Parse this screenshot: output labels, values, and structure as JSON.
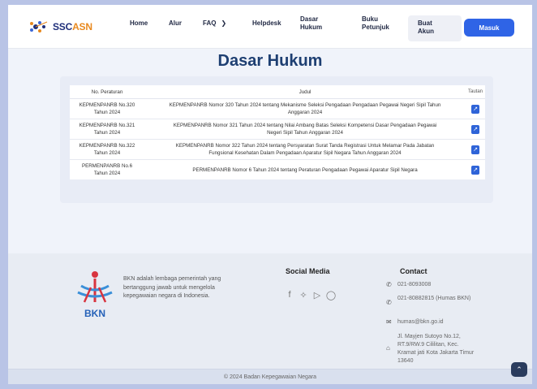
{
  "brand": {
    "logo_text_main": "SSC",
    "logo_text_accent": "ASN"
  },
  "nav": {
    "home": "Home",
    "alur": "Alur",
    "faq": "FAQ",
    "helpdesk": "Helpdesk",
    "dasar_hukum_l1": "Dasar",
    "dasar_hukum_l2": "Hukum",
    "buku_l1": "Buku",
    "buku_l2": "Petunjuk",
    "buat_l1": "Buat",
    "buat_l2": "Akun",
    "masuk": "Masuk"
  },
  "page": {
    "title": "Dasar Hukum"
  },
  "table": {
    "headers": [
      "No. Peraturan",
      "Judul",
      "Tautan"
    ],
    "rows": [
      {
        "no_l1": "KEPMENPANRB No.320",
        "no_l2": "Tahun 2024",
        "judul_l1": "KEPMENPANRB Nomor 320 Tahun 2024 tentang Mekanisme Seleksi Pengadaan Pengadaan Pegawai Negeri Sipil Tahun",
        "judul_l2": "Anggaran 2024"
      },
      {
        "no_l1": "KEPMENPANRB No.321",
        "no_l2": "Tahun 2024",
        "judul_l1": "KEPMENPANRB Nomor 321 Tahun 2024 tentang Nilai Ambang Batas Seleksi Kompetensi Dasar Pengadaan Pegawai",
        "judul_l2": "Negeri Sipil Tahun Anggaran 2024"
      },
      {
        "no_l1": "KEPMENPANRB No.322",
        "no_l2": "Tahun 2024",
        "judul_l1": "KEPMENPANRB Nomor 322 Tahun 2024 tentang Persyaratan Surat Tanda Registrasi Untuk Melamar Pada Jabatan",
        "judul_l2": "Fungsional Kesehatan Dalam Pengadaan Aparatur Sipil Negara Tahun Anggaran 2024"
      },
      {
        "no_l1": "PERMENPANRB No.6",
        "no_l2": "Tahun 2024",
        "judul_l1": "PERMENPANRB Nomor 6 Tahun 2024 tentang Peraturan Pengadaan Pegawai Aparatur Sipil Negara",
        "judul_l2": ""
      }
    ]
  },
  "footer": {
    "bkn_logo_text": "BKN",
    "bkn_desc": "BKN adalah lembaga pemerintah yang bertanggung jawab untuk mengelola kepegawaian negara di Indonesia.",
    "social_title": "Social Media",
    "contact_title": "Contact",
    "phone1": "021-8093008",
    "phone2": "021-80882815 (Humas BKN)",
    "email": "humas@bkn.go.id",
    "address": "Jl. Mayjen Sutoyo No.12, RT.9/RW.9 Cililitan, Kec. Kramat jati Kota Jakarta Timur 13640",
    "copyright": "© 2024  Badan Kepegawaian Negara"
  },
  "colors": {
    "primary": "#2f64e6",
    "title": "#1e3f72",
    "accent": "#e8891f"
  }
}
